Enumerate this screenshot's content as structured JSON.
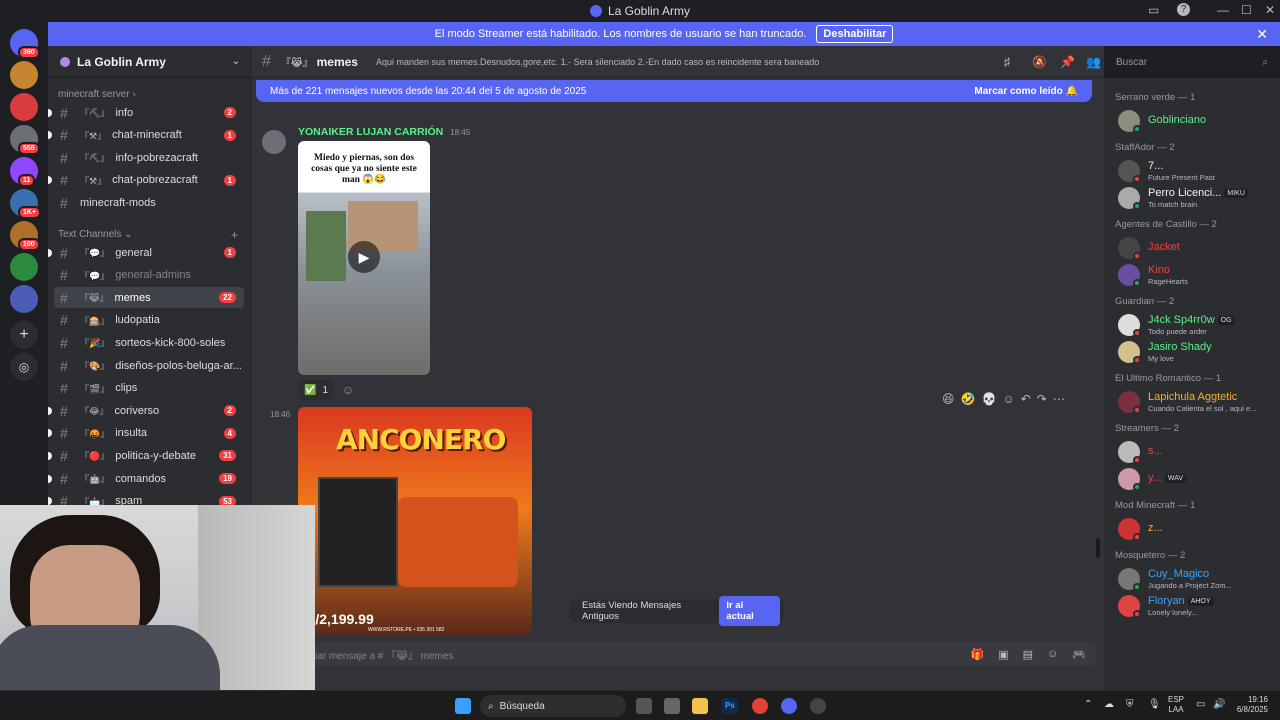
{
  "window": {
    "title": "La Goblin Army"
  },
  "banner": {
    "text": "El modo Streamer está habilitado. Los nombres de usuario se han truncado.",
    "button": "Deshabilitar"
  },
  "guilds": [
    {
      "color": "#5865f2",
      "badge": "390"
    },
    {
      "color": "#c6862f",
      "badge": ""
    },
    {
      "color": "#d83c3e",
      "badge": ""
    },
    {
      "color": "#6b7076",
      "badge": "555"
    },
    {
      "color": "#9146ff",
      "badge": "11"
    },
    {
      "color": "#3a6fb0",
      "badge": "1K+"
    },
    {
      "color": "#b0702c",
      "badge": "100"
    },
    {
      "color": "#2c8a3c",
      "badge": ""
    },
    {
      "color": "#4c5db8",
      "badge": ""
    }
  ],
  "server": {
    "name": "La Goblin Army"
  },
  "categories": {
    "minecraft": "minecraft server",
    "text": "Text Channels"
  },
  "minecraft_channels": [
    {
      "prefix": "『⛏』",
      "name": "info",
      "badge": "2"
    },
    {
      "prefix": "『⚒』",
      "name": "chat-minecraft",
      "badge": "1"
    },
    {
      "prefix": "『⛏』",
      "name": "info-pobrezacraft",
      "badge": ""
    },
    {
      "prefix": "『⚒』",
      "name": "chat-pobrezacraft",
      "badge": "1"
    },
    {
      "prefix": "",
      "name": "minecraft-mods",
      "badge": ""
    }
  ],
  "text_channels": [
    {
      "prefix": "『💬』",
      "name": "general",
      "badge": "1",
      "state": ""
    },
    {
      "prefix": "『💬』",
      "name": "general-admins",
      "badge": "",
      "state": "muted"
    },
    {
      "prefix": "『😹』",
      "name": "memes",
      "badge": "22",
      "state": "sel"
    },
    {
      "prefix": "『🎰』",
      "name": "ludopatia",
      "badge": "",
      "state": ""
    },
    {
      "prefix": "『🎉』",
      "name": "sorteos-kick-800-soles",
      "badge": "",
      "state": ""
    },
    {
      "prefix": "『🎨』",
      "name": "diseños-polos-beluga-ar...",
      "badge": "",
      "state": ""
    },
    {
      "prefix": "『🎬』",
      "name": "clips",
      "badge": "",
      "state": ""
    },
    {
      "prefix": "『😂』",
      "name": "coriverso",
      "badge": "2",
      "state": ""
    },
    {
      "prefix": "『🤬』",
      "name": "insulta",
      "badge": "4",
      "state": ""
    },
    {
      "prefix": "『🔴』",
      "name": "politica-y-debate",
      "badge": "31",
      "state": ""
    },
    {
      "prefix": "『🤖』",
      "name": "comandos",
      "badge": "19",
      "state": ""
    },
    {
      "prefix": "『📩』",
      "name": "spam",
      "badge": "53",
      "state": ""
    }
  ],
  "channel": {
    "prefix": "『😹』",
    "name": "memes",
    "topic": "Aqui manden sus memes.Desnudos,gore,etc. 1.- Sera silenciado 2.-En dado caso es reincidente sera baneado"
  },
  "search": {
    "placeholder": "Buscar"
  },
  "new_messages": {
    "text": "Más de 221 mensajes nuevos desde las 20:44 del 5 de agosto de 2025",
    "action": "Marcar como leído"
  },
  "messages": [
    {
      "author": "YONAIKER LUJAN CARRIÓN",
      "time": "18:45",
      "caption": "Miedo y piernas, son dos cosas que ya no siente este man 😱😂",
      "reaction": "✅",
      "reaction_count": "1"
    },
    {
      "time": "18:46",
      "image_title": "ANCONERO",
      "image_price": "S/2,199.99",
      "image_footer": "WWW.RSTORE.PE • 935 301 582"
    }
  ],
  "jump": {
    "text": "Estás Viendo Mensajes Antiguos",
    "button": "Ir al actual"
  },
  "composer": {
    "placeholder": "viar mensaje a # 『😹』 memes"
  },
  "member_groups": [
    {
      "label": "Serrano verde — 1",
      "members": [
        {
          "name": "Goblinciano",
          "sub": "",
          "color": "#57f287",
          "tag": "",
          "status": "#23a55a",
          "avatar": "#8a8f7a"
        }
      ]
    },
    {
      "label": "StaffAdor — 2",
      "members": [
        {
          "name": "7...",
          "sub": "Future Present Past",
          "color": "#f2f3f5",
          "tag": "",
          "status": "#f23f43",
          "avatar": "#555"
        },
        {
          "name": "Perro Licenci...",
          "sub": "To match brain",
          "color": "#f2f3f5",
          "tag": "MIKU",
          "status": "#23a55a",
          "avatar": "#aaa"
        }
      ]
    },
    {
      "label": "Agentes de Castillo — 2",
      "members": [
        {
          "name": "Jacket",
          "sub": "",
          "color": "#ed4245",
          "tag": "",
          "status": "#f23f43",
          "avatar": "#444"
        },
        {
          "name": "Kino",
          "sub": "RageHearts",
          "color": "#ed4245",
          "tag": "",
          "status": "#23a55a",
          "avatar": "#6a4fa0"
        }
      ]
    },
    {
      "label": "Guardian — 2",
      "members": [
        {
          "name": "J4ck Sp4rr0w",
          "sub": "Todo puede arder",
          "color": "#57f287",
          "tag": "OG",
          "status": "#f23f43",
          "avatar": "#ddd"
        },
        {
          "name": "Jasiro Shady",
          "sub": "My love",
          "color": "#57f287",
          "tag": "",
          "status": "#f23f43",
          "avatar": "#d4c08a"
        }
      ]
    },
    {
      "label": "El Ultimo Romantico — 1",
      "members": [
        {
          "name": "Lapichula Aggtetic",
          "sub": "Cuando Calienta el sol , aqui e...",
          "color": "#f0b232",
          "tag": "",
          "status": "#f23f43",
          "avatar": "#7a3040"
        }
      ]
    },
    {
      "label": "Streamers — 2",
      "members": [
        {
          "name": "s...",
          "sub": "",
          "color": "#ed4245",
          "tag": "",
          "status": "#f23f43",
          "avatar": "#bbb"
        },
        {
          "name": "y...",
          "sub": "",
          "color": "#ed4245",
          "tag": "WAV",
          "status": "#23a55a",
          "avatar": "#c9a"
        }
      ]
    },
    {
      "label": "Mod Minecraft — 1",
      "members": [
        {
          "name": "z...",
          "sub": "",
          "color": "#f0b232",
          "tag": "",
          "status": "#f23f43",
          "avatar": "#c33"
        }
      ]
    },
    {
      "label": "Mosquetero — 2",
      "members": [
        {
          "name": "Cuy_Magico",
          "sub": "Jugando a Project Zom...",
          "color": "#3ba5fc",
          "tag": "",
          "status": "#23a55a",
          "avatar": "#777"
        },
        {
          "name": "Floryan",
          "sub": "Lonely lonely...",
          "color": "#3ba5fc",
          "tag": "AHOY",
          "status": "#f23f43",
          "avatar": "#d44"
        }
      ]
    }
  ],
  "taskbar": {
    "search": "Búsqueda",
    "lang1": "ESP",
    "lang2": "LAA",
    "time": "19:16",
    "date": "6/8/2025"
  }
}
